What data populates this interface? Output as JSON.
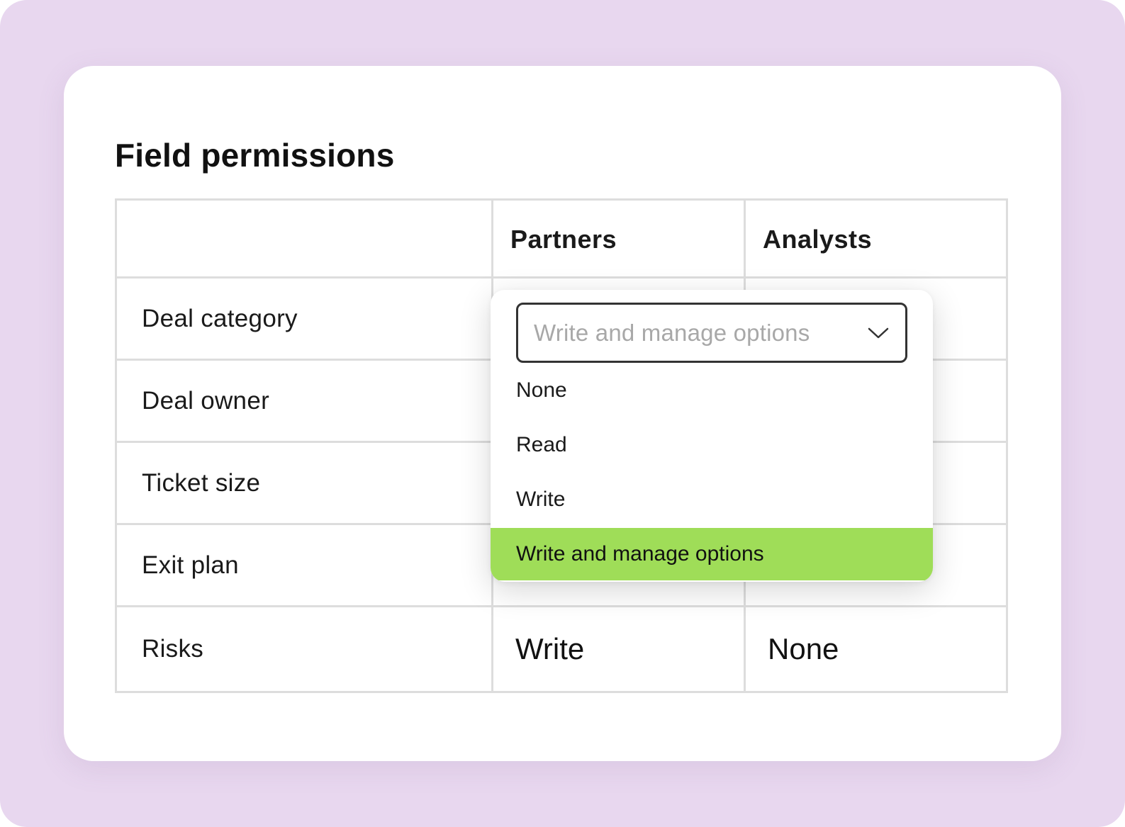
{
  "title": "Field permissions",
  "columns": {
    "partners": "Partners",
    "analysts": "Analysts"
  },
  "rows": [
    {
      "field": "Deal category",
      "partners": "",
      "analysts": ""
    },
    {
      "field": "Deal owner",
      "partners": "",
      "analysts": ""
    },
    {
      "field": "Ticket size",
      "partners": "",
      "analysts": ""
    },
    {
      "field": "Exit plan",
      "partners": "",
      "analysts": ""
    },
    {
      "field": "Risks",
      "partners": "Write",
      "analysts": "None"
    }
  ],
  "dropdown": {
    "placeholder": "Write and manage options",
    "options": [
      "None",
      "Read",
      "Write",
      "Write and manage options"
    ],
    "selected_index": 3,
    "highlight_color": "#9fdd58"
  },
  "icons": {
    "dropdown_chevron": "chevron-down-icon"
  }
}
